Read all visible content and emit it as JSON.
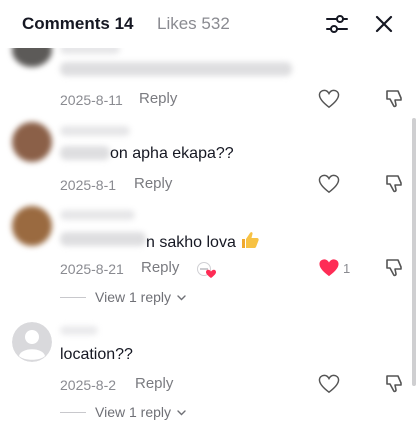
{
  "header": {
    "comments_tab": "Comments 14",
    "likes_tab": "Likes 532"
  },
  "comments": [
    {
      "text": "",
      "date": "2025-8-11",
      "reply": "Reply",
      "liked": false,
      "likes": ""
    },
    {
      "text": "on apha ekapa??",
      "date": "2025-8-1",
      "reply": "Reply",
      "liked": false,
      "likes": ""
    },
    {
      "text": "n sakho lova",
      "date": "2025-8-21",
      "reply": "Reply",
      "liked": true,
      "likes": "1",
      "view_replies": "View 1 reply"
    },
    {
      "text": "location??",
      "date": "2025-8-2",
      "reply": "Reply",
      "liked": false,
      "likes": "",
      "view_replies": "View 1 reply"
    }
  ],
  "colors": {
    "like_red": "#fe2c55",
    "muted": "#8a8b91",
    "text": "#161823"
  },
  "icons": [
    "filter-icon",
    "close-icon",
    "heart-icon",
    "dislike-icon",
    "chevron-down-icon",
    "thumbs-up-emoji"
  ]
}
